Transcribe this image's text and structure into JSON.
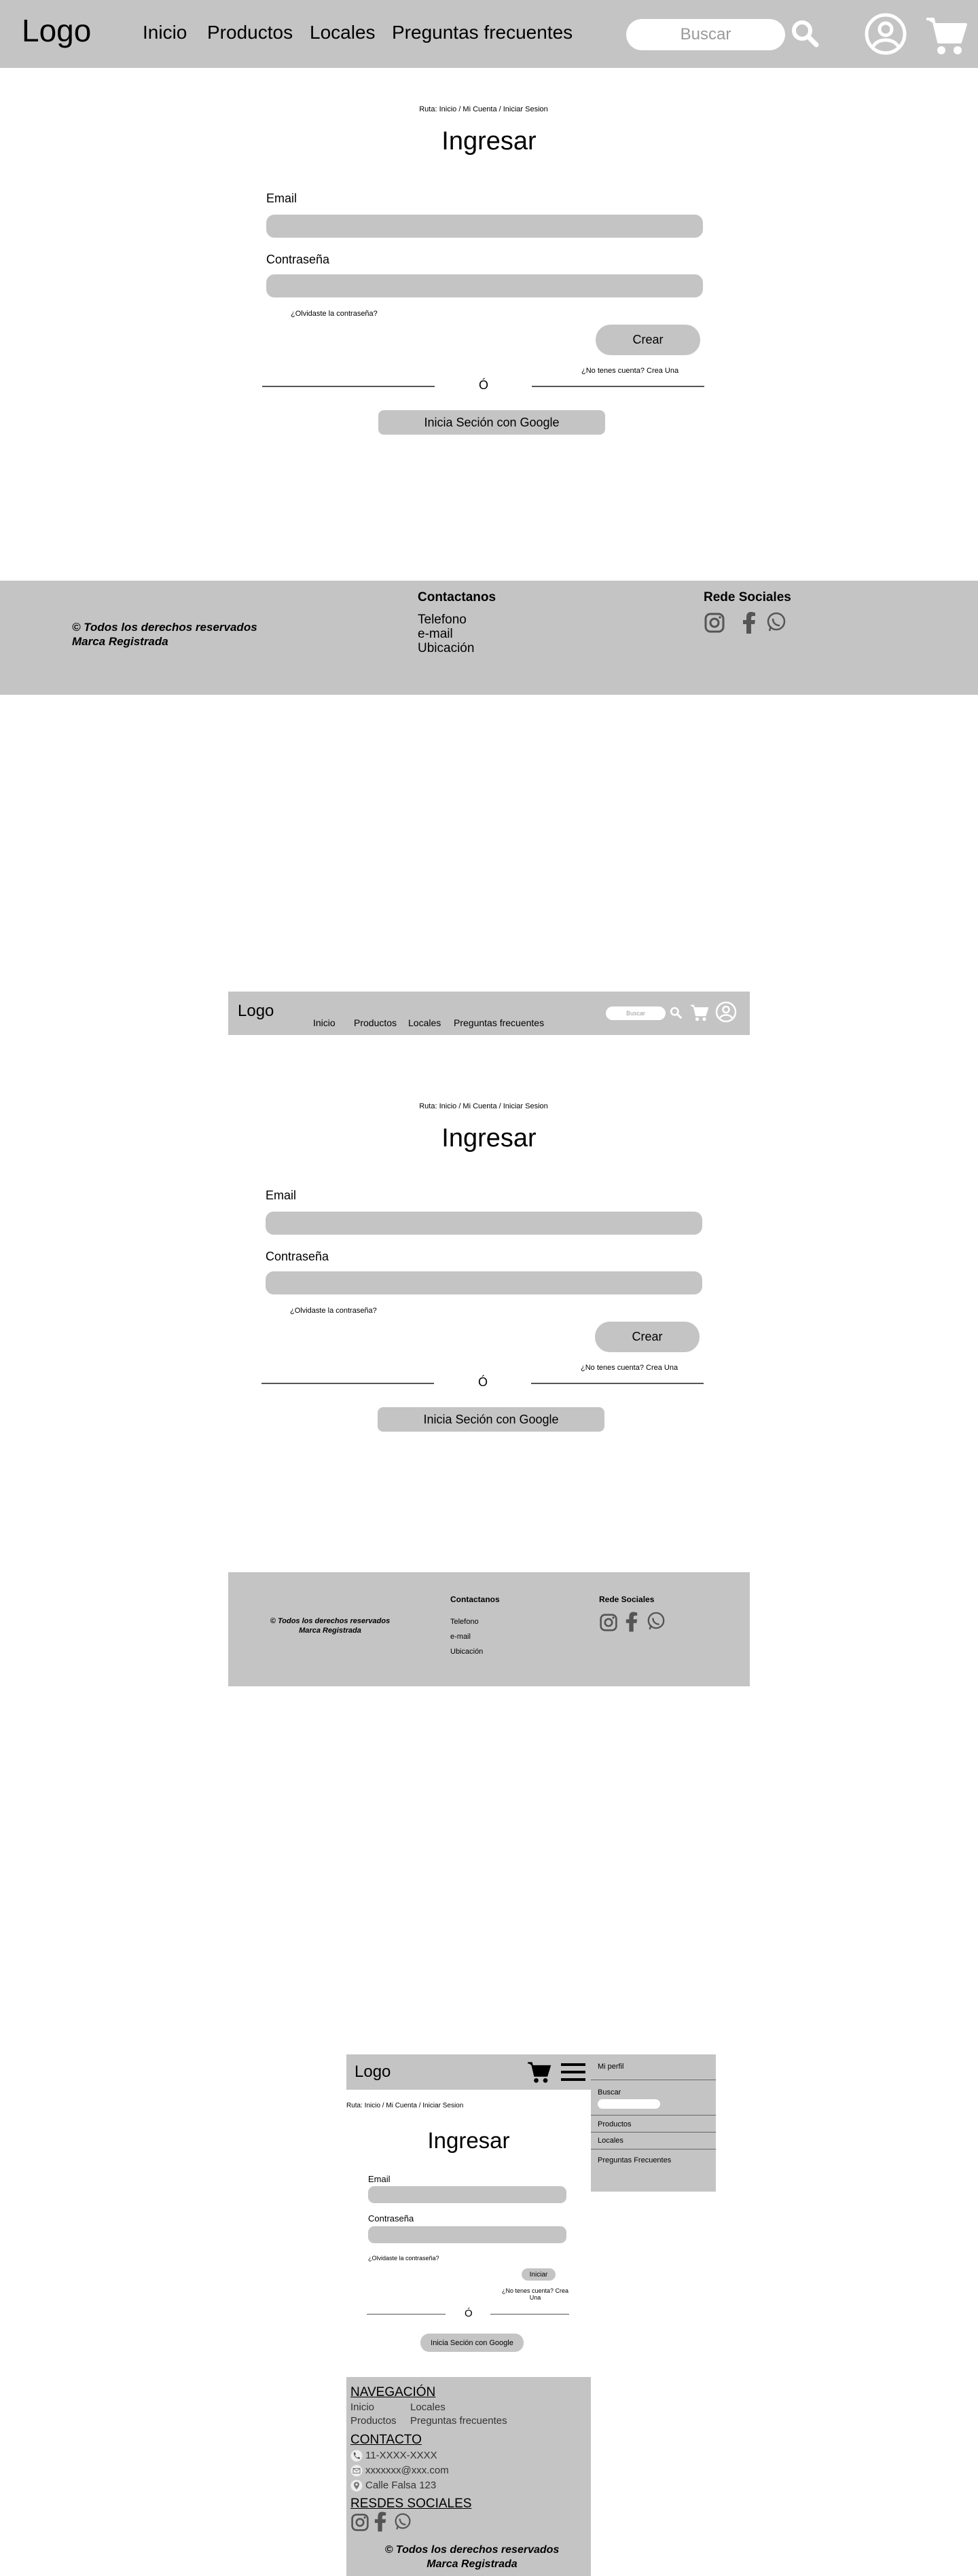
{
  "nav": {
    "logo": "Logo",
    "items": [
      "Inicio",
      "Productos",
      "Locales",
      "Preguntas frecuentes"
    ],
    "search_placeholder": "Buscar"
  },
  "login": {
    "breadcrumb": "Ruta: Inicio / Mi Cuenta / Iniciar Sesion",
    "title": "Ingresar",
    "email_label": "Email",
    "password_label": "Contraseña",
    "forgot": "¿Olvidaste la contraseña?",
    "create_button": "Crear",
    "mobile_button": "Iniciar",
    "no_account": "¿No tenes cuenta? Crea Una",
    "or": "Ó",
    "google_button": "Inicia Seción con Google"
  },
  "footer": {
    "rights_line1": "© Todos los derechos reservados",
    "rights_line2": "Marca Registrada",
    "contact_title": "Contactanos",
    "contact_items": [
      "Telefono",
      "e-mail",
      "Ubicación"
    ],
    "social_title": "Rede Sociales",
    "social_icons": [
      "instagram-icon",
      "facebook-icon",
      "whatsapp-icon"
    ]
  },
  "mobile_menu": {
    "profile": "Mi perfil",
    "search": "Buscar",
    "items": [
      "Productos",
      "Locales",
      "Preguntas Frecuentes"
    ]
  },
  "mobile_footer": {
    "nav_title": "NAVEGACIÓN",
    "nav_items": [
      "Inicio",
      "Locales",
      "Productos",
      "Preguntas frecuentes"
    ],
    "contact_title": "CONTACTO",
    "phone": "11-XXXX-XXXX",
    "email": "xxxxxxx@xxx.com",
    "address": "Calle Falsa 123",
    "social_title": "RESDES SOCIALES"
  },
  "colors": {
    "panel": "#c4c4c4",
    "line": "#555555"
  }
}
